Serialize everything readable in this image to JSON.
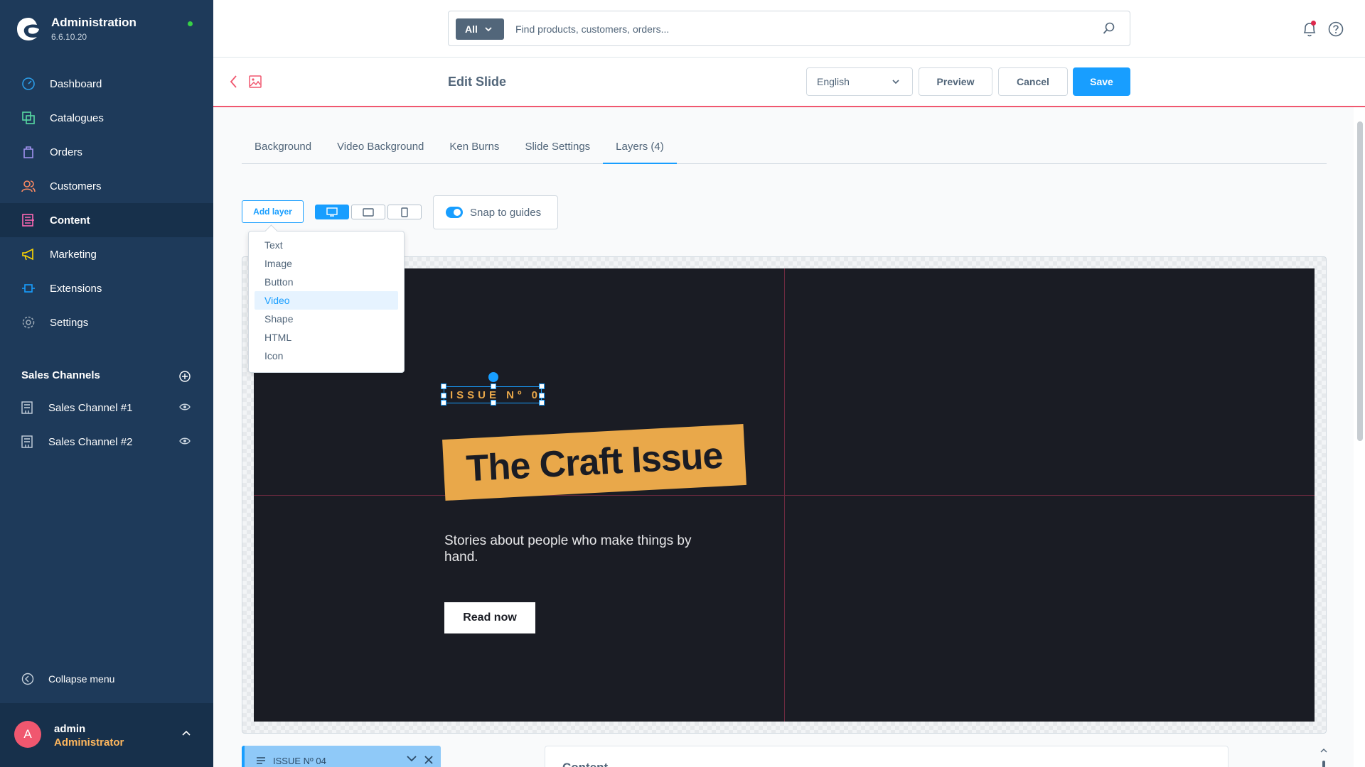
{
  "app": {
    "title": "Administration",
    "version": "6.6.10.20"
  },
  "sidebar": {
    "items": [
      {
        "label": "Dashboard",
        "icon": "dashboard-icon"
      },
      {
        "label": "Catalogues",
        "icon": "catalogues-icon"
      },
      {
        "label": "Orders",
        "icon": "orders-icon"
      },
      {
        "label": "Customers",
        "icon": "customers-icon"
      },
      {
        "label": "Content",
        "icon": "content-icon",
        "active": true
      },
      {
        "label": "Marketing",
        "icon": "marketing-icon"
      },
      {
        "label": "Extensions",
        "icon": "extensions-icon"
      },
      {
        "label": "Settings",
        "icon": "settings-icon"
      }
    ],
    "sales_channels_title": "Sales Channels",
    "sales_channels": [
      {
        "label": "Sales Channel #1"
      },
      {
        "label": "Sales Channel #2"
      }
    ],
    "collapse_label": "Collapse menu"
  },
  "user": {
    "initial": "A",
    "name": "admin",
    "role": "Administrator"
  },
  "search": {
    "scope": "All",
    "placeholder": "Find products, customers, orders..."
  },
  "smartbar": {
    "title": "Edit Slide",
    "language": "English",
    "preview_label": "Preview",
    "cancel_label": "Cancel",
    "save_label": "Save"
  },
  "tabs": [
    {
      "label": "Background"
    },
    {
      "label": "Video Background"
    },
    {
      "label": "Ken Burns"
    },
    {
      "label": "Slide Settings"
    },
    {
      "label": "Layers (4)",
      "active": true
    }
  ],
  "toolbar": {
    "add_layer_label": "Add layer",
    "snap_label": "Snap to guides",
    "snap_enabled": true
  },
  "add_layer_menu": {
    "items": [
      "Text",
      "Image",
      "Button",
      "Video",
      "Shape",
      "HTML",
      "Icon"
    ],
    "selected": "Video"
  },
  "slide": {
    "issue_text": "ISSUE Nº 04",
    "headline": "The Craft Issue",
    "subtitle": "Stories about people who make things by hand.",
    "button_label": "Read now"
  },
  "layers_panel": {
    "selected_layer_label": "ISSUE Nº 04"
  },
  "content_panel": {
    "title": "Content"
  },
  "colors": {
    "accent": "#189eff",
    "sidebar": "#1e3a5a",
    "slide_bg": "#1a1c24",
    "highlight": "#e9a84a",
    "guide": "#f0576f"
  }
}
